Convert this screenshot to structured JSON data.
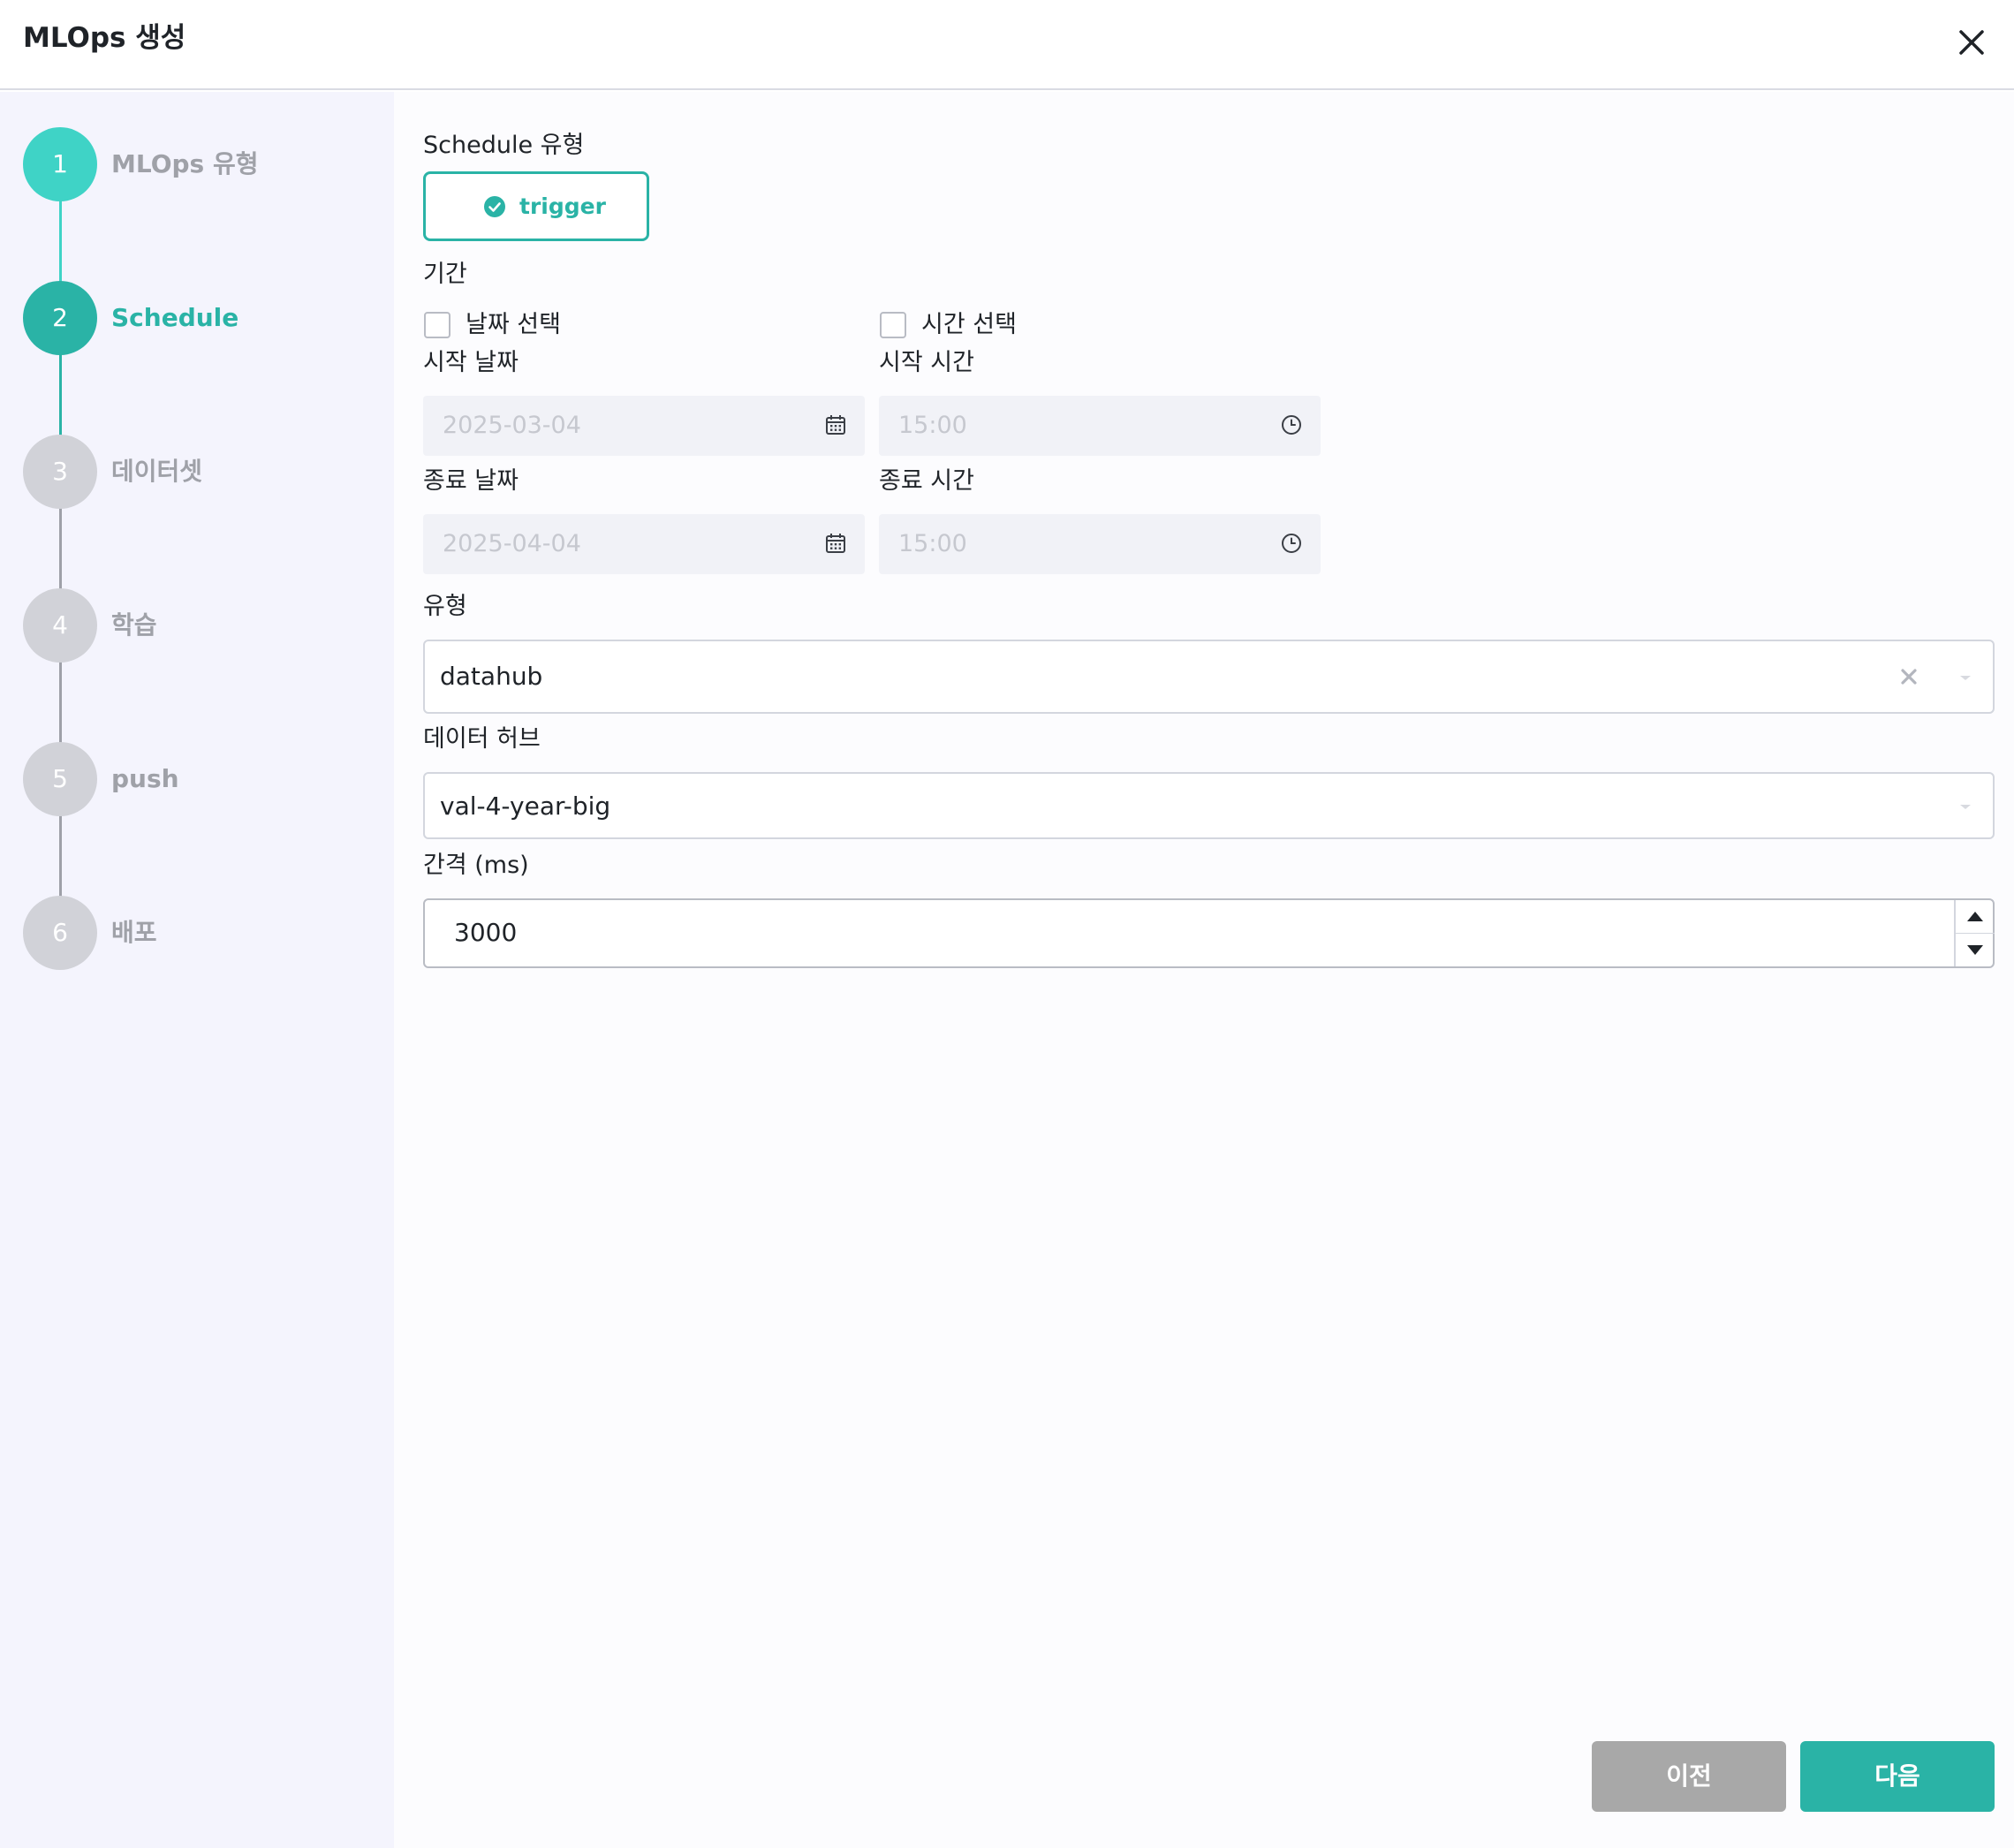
{
  "dialog": {
    "title": "MLOps 생성"
  },
  "steps": [
    {
      "number": "1",
      "label": "MLOps 유형",
      "state": "completed"
    },
    {
      "number": "2",
      "label": "Schedule",
      "state": "active"
    },
    {
      "number": "3",
      "label": "데이터셋",
      "state": "pending"
    },
    {
      "number": "4",
      "label": "학습",
      "state": "pending"
    },
    {
      "number": "5",
      "label": "push",
      "state": "pending"
    },
    {
      "number": "6",
      "label": "배포",
      "state": "pending"
    }
  ],
  "form": {
    "schedule_type_label": "Schedule 유형",
    "schedule_type_option": "trigger",
    "period_label": "기간",
    "date_select_label": "날짜 선택",
    "date_select_checked": false,
    "time_select_label": "시간 선택",
    "time_select_checked": false,
    "start_date_label": "시작 날짜",
    "start_date_value": "2025-03-04",
    "start_time_label": "시작 시간",
    "start_time_value": "15:00",
    "end_date_label": "종료 날짜",
    "end_date_value": "2025-04-04",
    "end_time_label": "종료 시간",
    "end_time_value": "15:00",
    "type_label": "유형",
    "type_value": "datahub",
    "datahub_label": "데이터 허브",
    "datahub_value": "val-4-year-big",
    "interval_label": "간격 (ms)",
    "interval_value": "3000"
  },
  "footer": {
    "prev_label": "이전",
    "next_label": "다음"
  },
  "colors": {
    "accent": "#2ab3a6",
    "step_completed": "#3fd3c6",
    "step_pending": "#d1d2d8",
    "prev_button": "#a8a8a8",
    "sidebar_bg": "#f4f4fd"
  },
  "icons": {
    "close": "close-icon",
    "check": "check-circle-icon",
    "calendar": "calendar-icon",
    "clock": "clock-icon",
    "clear": "clear-icon",
    "dropdown": "chevron-down-icon",
    "spin_up": "triangle-up-icon",
    "spin_down": "triangle-down-icon"
  }
}
